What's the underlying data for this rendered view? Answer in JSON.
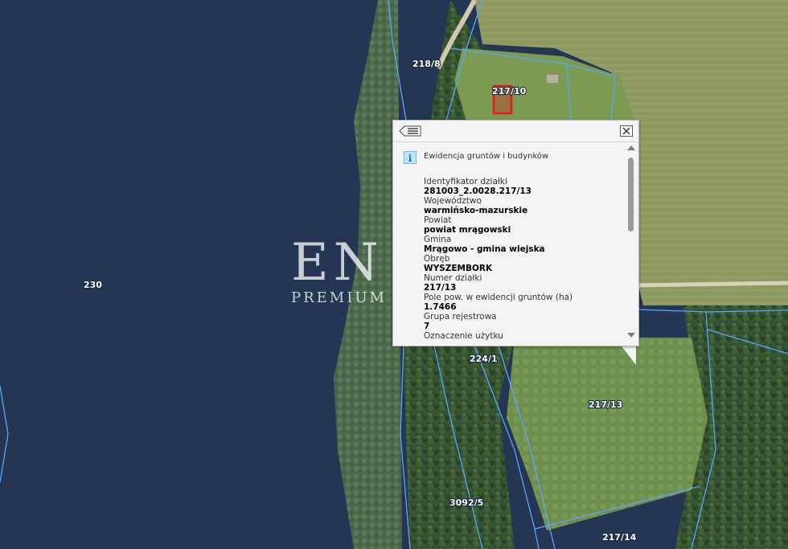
{
  "map": {
    "parcel_labels": [
      "218/8",
      "217/10",
      "230",
      "224/1",
      "217/13",
      "3092/5",
      "217/14"
    ],
    "parcel_line_color": "#58a6ff",
    "selected_building_color": "#e02020",
    "water_color": "#243653",
    "field_color": "#8f9a63"
  },
  "watermark": {
    "main": "EN CASA",
    "sub": "PREMIUM REAL ESTATE"
  },
  "popup": {
    "list_icon": "list-back-icon",
    "close_icon": "close-icon",
    "info_icon": "i",
    "layer_title": "Ewidencja gruntów i budynków",
    "attributes": [
      {
        "name": "Identyfikator działki",
        "value": "281003_2.0028.217/13"
      },
      {
        "name": "Województwo",
        "value": "warmińsko-mazurskie"
      },
      {
        "name": "Powiat",
        "value": "powiat mrągowski"
      },
      {
        "name": "Gmina",
        "value": "Mrągowo - gmina wiejska"
      },
      {
        "name": "Obręb",
        "value": "WYSZEMBORK"
      },
      {
        "name": "Numer działki",
        "value": "217/13"
      },
      {
        "name": "Pole pow. w ewidencji gruntów (ha)",
        "value": "1.7466"
      },
      {
        "name": "Grupa rejestrowa",
        "value": "7"
      },
      {
        "name": "Oznaczenie użytku",
        "value": ""
      }
    ]
  }
}
